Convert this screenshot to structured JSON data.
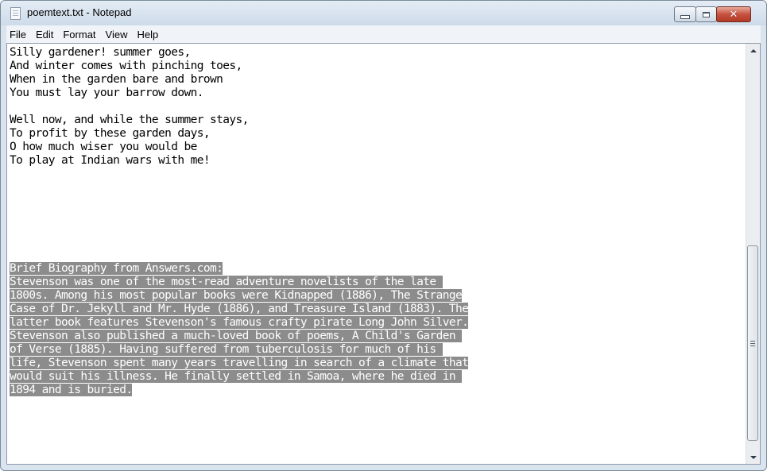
{
  "window": {
    "title": "poemtext.txt - Notepad",
    "icon": "notepad-icon",
    "controls": {
      "minimize": "minimize-icon",
      "maximize": "maximize-icon",
      "close": "close-icon",
      "close_glyph": "✕"
    }
  },
  "menu": [
    {
      "label": "File"
    },
    {
      "label": "Edit"
    },
    {
      "label": "Format"
    },
    {
      "label": "View"
    },
    {
      "label": "Help"
    }
  ],
  "document": {
    "lines": [
      "Silly gardener! summer goes,",
      "And winter comes with pinching toes,",
      "When in the garden bare and brown",
      "You must lay your barrow down.",
      "",
      "Well now, and while the summer stays,",
      "To profit by these garden days,",
      "O how much wiser you would be",
      "To play at Indian wars with me!",
      "",
      "",
      "",
      "",
      "",
      "",
      "",
      "Brief Biography from Answers.com:",
      "Stevenson was one of the most-read adventure novelists of the late ",
      "1800s. Among his most popular books were Kidnapped (1886), The Strange",
      "Case of Dr. Jekyll and Mr. Hyde (1886), and Treasure Island (1883). The",
      "latter book features Stevenson's famous crafty pirate Long John Silver.",
      "Stevenson also published a much-loved book of poems, A Child's Garden ",
      "of Verse (1885). Having suffered from tuberculosis for much of his ",
      "life, Stevenson spent many years travelling in search of a climate that",
      "would suit his illness. He finally settled in Samoa, where he died in ",
      "1894 and is buried."
    ],
    "selection_start_line": 16,
    "selection_color": "#8c8c8c"
  },
  "scrollbar": {
    "up_icon": "scroll-up-arrow-icon",
    "down_icon": "scroll-down-arrow-icon",
    "thumb_icon": "scroll-grip-icon"
  }
}
